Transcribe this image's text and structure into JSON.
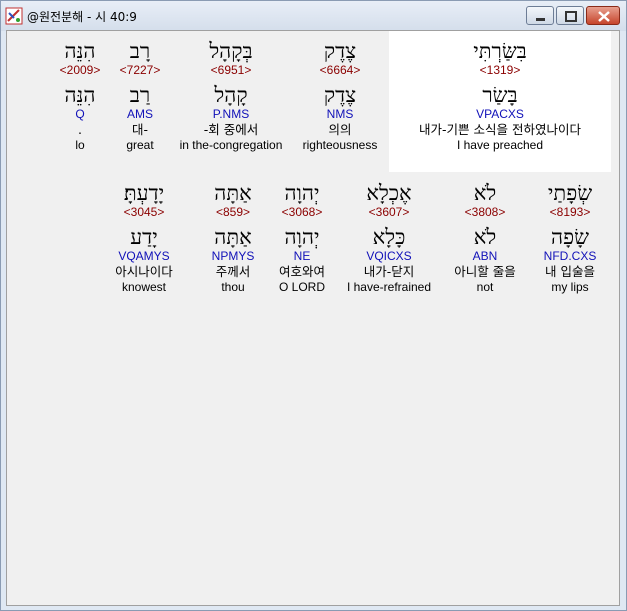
{
  "window": {
    "title": "@원전분해 - 시 40:9"
  },
  "controls": {
    "minimize": "minimize",
    "maximize": "maximize",
    "close": "close"
  },
  "rows": [
    {
      "words": [
        {
          "heb": "הִנֵּה",
          "strong": "<2009>",
          "lemma": "הִנֵּה",
          "parse": "Q",
          "kor": ".",
          "eng": "lo"
        },
        {
          "heb": "רָב",
          "strong": "<7227>",
          "lemma": "רַב",
          "parse": "AMS",
          "kor": "대-",
          "eng": "great"
        },
        {
          "heb": "בְּקָהָל",
          "strong": "<6951>",
          "lemma": "קָהָל",
          "parse": "P.NMS",
          "kor": "-회 중에서",
          "eng": "in the-congregation"
        },
        {
          "heb": "צֶדֶק",
          "strong": "<6664>",
          "lemma": "צֶדֶק",
          "parse": "NMS",
          "kor": "의의",
          "eng": "righteousness"
        },
        {
          "heb": "בִּשַּׂרְתִּי",
          "strong": "<1319>",
          "lemma": "בָּשַׂר",
          "parse": "VPACXS",
          "kor": "내가-기쁜 소식을 전하였나이다",
          "eng": "I have preached"
        }
      ]
    },
    {
      "words": [
        {
          "heb": "יָדָעְתָּ׃",
          "strong": "<3045>",
          "lemma": "יָדַע",
          "parse": "VQAMYS",
          "kor": "아시나이다",
          "eng": "knowest"
        },
        {
          "heb": "אַתָּה",
          "strong": "<859>",
          "lemma": "אַתָּה",
          "parse": "NPMYS",
          "kor": "주께서",
          "eng": "thou"
        },
        {
          "heb": "יְהוָה",
          "strong": "<3068>",
          "lemma": "יְהוָה",
          "parse": "NE",
          "kor": "여호와여",
          "eng": "O LORD"
        },
        {
          "heb": "אֶכְלָא",
          "strong": "<3607>",
          "lemma": "כָּלָא",
          "parse": "VQICXS",
          "kor": "내가-닫지",
          "eng": "I have-refrained"
        },
        {
          "heb": "לֹא",
          "strong": "<3808>",
          "lemma": "לֹא",
          "parse": "ABN",
          "kor": "아니할 줄을",
          "eng": "not"
        },
        {
          "heb": "שְׂפָתַי",
          "strong": "<8193>",
          "lemma": "שָׂפָה",
          "parse": "NFD.CXS",
          "kor": "내 입술을",
          "eng": "my lips"
        }
      ]
    }
  ]
}
